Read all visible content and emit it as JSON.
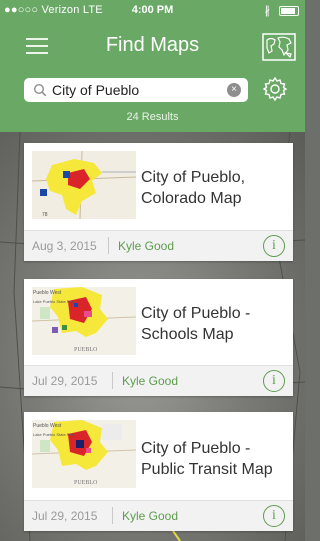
{
  "status_bar": {
    "carrier": "●●○○○ Verizon  LTE",
    "time": "4:00 PM",
    "bluetooth": "∦"
  },
  "nav": {
    "title": "Find Maps",
    "menu_icon": "hamburger-menu-icon",
    "right_icon": "world-map-icon"
  },
  "search": {
    "value": "City of Pueblo",
    "clear": "×",
    "results": "24 Results"
  },
  "colors": {
    "header": "#6aa866",
    "accent": "#5e9c4e"
  },
  "cards": [
    {
      "title": "City of Pueblo, Colorado Map",
      "date": "Aug 3, 2015",
      "author": "Kyle Good",
      "info": "i"
    },
    {
      "title": "City of Pueblo - Schools Map",
      "date": "Jul 29, 2015",
      "author": "Kyle Good",
      "info": "i",
      "thumb_labels": [
        "Pueblo West",
        "Lake Pueblo State Park",
        "PUEBLO"
      ]
    },
    {
      "title": "City of Pueblo - Public Transit Map",
      "date": "Jul 29, 2015",
      "author": "Kyle Good",
      "info": "i",
      "thumb_labels": [
        "Pueblo West",
        "Lake Pueblo State Park",
        "PUEBLO"
      ]
    }
  ]
}
